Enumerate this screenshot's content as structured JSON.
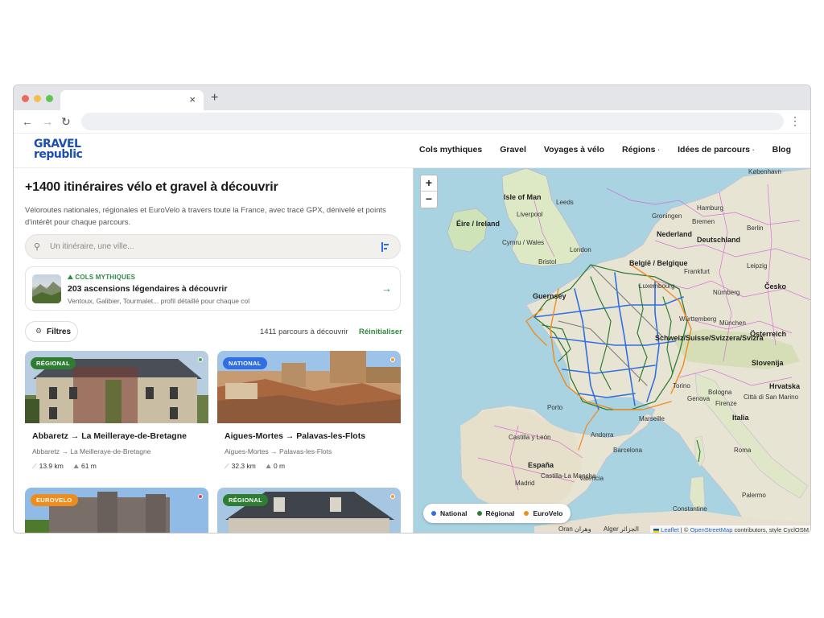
{
  "browser": {
    "tab_close": "×",
    "new_tab": "+",
    "back": "←",
    "forward": "→",
    "reload": "↻",
    "menu": "⋮"
  },
  "site": {
    "logo_line1": "GRAVEL",
    "logo_line2": "republic",
    "logo_color": "#1c4fb3",
    "accent_green": "#2e8a3e",
    "nav": [
      {
        "label": "Cols mythiques",
        "caret": ""
      },
      {
        "label": "Gravel",
        "caret": ""
      },
      {
        "label": "Voyages à vélo",
        "caret": ""
      },
      {
        "label": "Régions",
        "caret": "·"
      },
      {
        "label": "Idées de parcours",
        "caret": "·"
      },
      {
        "label": "Blog",
        "caret": ""
      }
    ]
  },
  "hero": {
    "title": "+1400 itinéraires vélo et gravel à découvrir",
    "intro": "Véloroutes nationales, régionales et EuroVelo à travers toute la France, avec tracé GPX, dénivelé et points d'intérêt pour chaque parcours."
  },
  "search": {
    "placeholder": "Un itinéraire, une ville..."
  },
  "promo": {
    "tag": "COLS MYTHIQUES",
    "title": "203 ascensions légendaires à découvrir",
    "subtitle": "Ventoux, Galibier, Tourmalet... profil détaillé pour chaque col",
    "arrow": "→"
  },
  "list": {
    "filters_label": "Filtres",
    "count": "1411 parcours à découvrir",
    "reset": "Réinitialiser"
  },
  "cards": [
    {
      "badge": "RÉGIONAL",
      "badge_color": "#2e7d32",
      "dot_color": "#43a047",
      "title": "Abbaretz → La Meilleraye-de-Bretagne",
      "subtitle": "Abbaretz → La Meilleraye-de-Bretagne",
      "distance": "13.9 km",
      "elevation": "61 m"
    },
    {
      "badge": "NATIONAL",
      "badge_color": "#2f6fe0",
      "dot_color": "#f29a2e",
      "title": "Aigues-Mortes → Palavas-les-Flots",
      "subtitle": "Aigues-Mortes → Palavas-les-Flots",
      "distance": "32.3 km",
      "elevation": "0 m"
    },
    {
      "badge": "EUROVELO",
      "badge_color": "#ef8c1e",
      "dot_color": "#e53935",
      "title": "",
      "subtitle": "",
      "distance": "",
      "elevation": ""
    },
    {
      "badge": "RÉGIONAL",
      "badge_color": "#2e7d32",
      "dot_color": "#f29a2e",
      "title": "",
      "subtitle": "",
      "distance": "",
      "elevation": ""
    }
  ],
  "map": {
    "zoom_in": "+",
    "zoom_out": "−",
    "legend": [
      {
        "label": "National",
        "color": "#2f6fe0"
      },
      {
        "label": "Régional",
        "color": "#2e7d32"
      },
      {
        "label": "EuroVelo",
        "color": "#ef8c1e"
      }
    ],
    "attribution_leaflet": "Leaflet",
    "attribution_sep": " | © ",
    "attribution_osm": "OpenStreetMap",
    "attribution_rest": " contributors, style CyclOSM",
    "labels": {
      "kobenhavn": "København",
      "isle_of_man": "Isle of Man",
      "leeds": "Leeds",
      "hamburg": "Hamburg",
      "eire": "Éire / Ireland",
      "liverpool": "Liverpool",
      "groningen": "Groningen",
      "bremen": "Bremen",
      "berlin": "Berlin",
      "cymru": "Cymru / Wales",
      "nederland": "Nederland",
      "deutschland": "Deutschland",
      "london": "London",
      "bristol": "Bristol",
      "belgie": "België / Belgique",
      "leipzig": "Leipzig",
      "frankfurt": "Frankfurt",
      "cesko": "Česko",
      "guernsey": "Guernsey",
      "luxembourg": "Luxembourg",
      "nurnberg": "Nürnberg",
      "wurttemberg": "Württemberg",
      "munchen": "München",
      "osterreich": "Österreich",
      "schweiz": "Schweiz/Suisse/Svizzera/Svizra",
      "slovenija": "Slovenija",
      "hrvatska": "Hrvatska",
      "torino": "Torino",
      "genova": "Genova",
      "bologna": "Bologna",
      "italia": "Italia",
      "firenze": "Firenze",
      "citta": "Città di San Marino",
      "porto": "Porto",
      "marseille": "Marseille",
      "andorra": "Andorra",
      "castilla": "Castilla y León",
      "barcelona": "Barcelona",
      "espana": "España",
      "madrid": "Madrid",
      "lamancha": "Castilla-La Mancha",
      "valencia": "València",
      "roma": "Roma",
      "palermo": "Palermo",
      "constantine": "Constantine",
      "algier": "Alger الجزائر",
      "oran": "Oran وهران"
    }
  }
}
